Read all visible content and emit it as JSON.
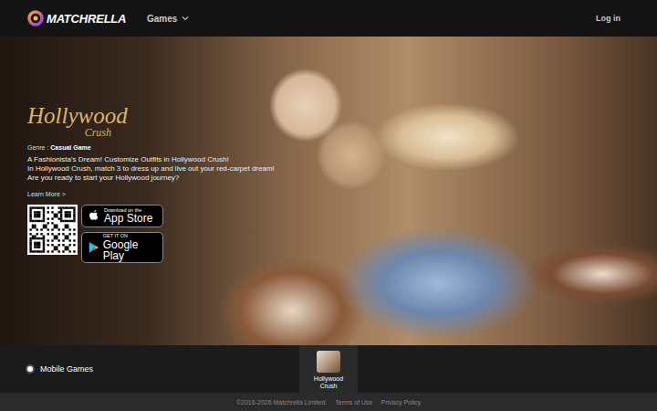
{
  "nav": {
    "logo": "MATCHRELLA",
    "menu": [
      {
        "label": "Games",
        "expanded": false
      }
    ],
    "login": "Log in"
  },
  "hero": {
    "game_logo": {
      "title": "Hollywood",
      "subtitle": "Crush"
    },
    "genre_label": "Genre : ",
    "genre": "Casual Game",
    "description": [
      "A Fashionista's Dream! Customize Outfits in Hollywood Crush!",
      "In Hollywood Crush, match 3 to dress up and live out your red-carpet dream!",
      "Are you ready to start your Hollywood journey?"
    ],
    "learn_more": "Learn More >",
    "stores": [
      {
        "kind": "apple",
        "small": "Download on the",
        "big": "App Store"
      },
      {
        "kind": "google",
        "small": "GET IT ON",
        "big": "Google Play"
      }
    ]
  },
  "category": {
    "label": "Mobile Games",
    "selected": true
  },
  "games": [
    {
      "name": "Hollywood Crush",
      "selected": true
    }
  ],
  "footer": {
    "copyright": "©2016-2026 Matchrella Limited.",
    "links": [
      "Terms of Use",
      "Privacy Policy"
    ]
  }
}
